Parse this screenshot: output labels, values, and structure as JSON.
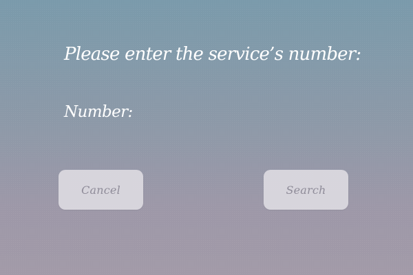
{
  "dialog": {
    "prompt": "Please enter the service’s number:",
    "number_label": "Number:",
    "number_value": "",
    "cancel_label": "Cancel",
    "search_label": "Search"
  },
  "colors": {
    "background_top": "#7a9aab",
    "background_bottom": "#a29aa8",
    "text": "#ffffff",
    "button_fill": "#dcdae1",
    "button_text": "#8f8c99"
  }
}
